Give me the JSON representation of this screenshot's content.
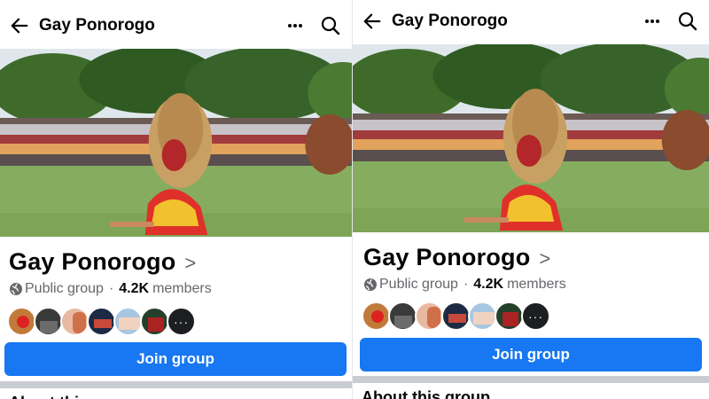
{
  "group": {
    "name": "Gay Ponorogo",
    "privacy": "Public group",
    "separator": "·",
    "member_count": "4.2K",
    "member_label": "members",
    "more_members": "···",
    "join_label": "Join group",
    "about_title": "About this group"
  },
  "icons": {
    "back": "arrow-left",
    "more": "three-dots",
    "search": "magnifier",
    "chevron": ">",
    "privacy": "globe"
  },
  "colors": {
    "accent": "#1877f2",
    "text": "#050505",
    "secondary_text": "#65676b",
    "divider": "#c9ccd1"
  }
}
